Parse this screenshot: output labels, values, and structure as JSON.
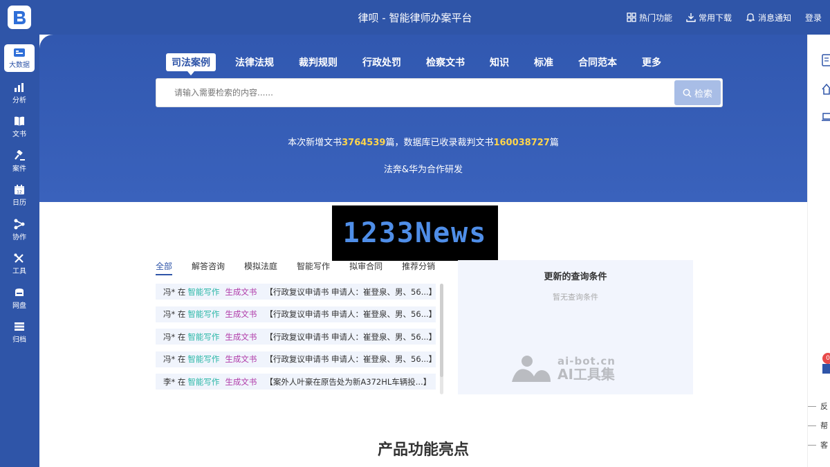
{
  "header": {
    "title": "律呗 - 智能律师办案平台",
    "actions": [
      {
        "label": "热门功能",
        "icon": "grid-icon"
      },
      {
        "label": "常用下载",
        "icon": "download-icon"
      },
      {
        "label": "消息通知",
        "icon": "bell-icon"
      }
    ],
    "login_label": "登录"
  },
  "sidebar": {
    "items": [
      {
        "label": "大数据",
        "icon": "big-data-icon",
        "active": true
      },
      {
        "label": "分析",
        "icon": "chart-icon"
      },
      {
        "label": "文书",
        "icon": "book-icon"
      },
      {
        "label": "案件",
        "icon": "gavel-icon"
      },
      {
        "label": "日历",
        "icon": "calendar-icon"
      },
      {
        "label": "协作",
        "icon": "share-icon"
      },
      {
        "label": "工具",
        "icon": "tools-icon"
      },
      {
        "label": "网盘",
        "icon": "cloud-disk-icon"
      },
      {
        "label": "归档",
        "icon": "archive-icon"
      }
    ]
  },
  "search": {
    "tabs": [
      "司法案例",
      "法律法规",
      "裁判规则",
      "行政处罚",
      "检察文书",
      "知识",
      "标准",
      "合同范本",
      "更多"
    ],
    "active_tab": "司法案例",
    "placeholder": "请输入需要检索的内容......",
    "button_label": "检索"
  },
  "stats": {
    "prefix": "本次新增文书",
    "new_docs": "3764539",
    "middle": "篇，数据库已收录裁判文书",
    "total_docs": "160038727",
    "suffix": "篇"
  },
  "partner_text": "法奔&华为合作研发",
  "news_logo": "1233News",
  "activity": {
    "tabs": [
      "全部",
      "解答咨询",
      "模拟法庭",
      "智能写作",
      "拟审合同",
      "推荐分销"
    ],
    "active_tab": "全部",
    "rows": [
      {
        "who": "冯* 在",
        "tool": "智能写作",
        "action": "生成文书",
        "doc": "【行政复议申请书 申请人：崔登泉、男、56...】"
      },
      {
        "who": "冯* 在",
        "tool": "智能写作",
        "action": "生成文书",
        "doc": "【行政复议申请书 申请人：崔登泉、男、56...】"
      },
      {
        "who": "冯* 在",
        "tool": "智能写作",
        "action": "生成文书",
        "doc": "【行政复议申请书 申请人：崔登泉、男、56...】"
      },
      {
        "who": "冯* 在",
        "tool": "智能写作",
        "action": "生成文书",
        "doc": "【行政复议申请书 申请人：崔登泉、男、56...】"
      },
      {
        "who": "李* 在",
        "tool": "智能写作",
        "action": "生成文书",
        "doc": "【案外人叶豪在原告处为新A372HL车辆投...】"
      }
    ]
  },
  "query_panel": {
    "title": "更新的查询条件",
    "empty_text": "暂无查询条件",
    "watermark_line1": "ai-bot.cn",
    "watermark_line2": "AI工具集"
  },
  "section_title": "产品功能亮点",
  "right_panel": {
    "badge": "0",
    "links": [
      "反",
      "帮",
      "客"
    ]
  },
  "colors": {
    "brand": "#2f55a8",
    "highlight_number": "#ffd54a",
    "tool_text": "#2bb7a7",
    "action_text": "#b03aa9"
  }
}
